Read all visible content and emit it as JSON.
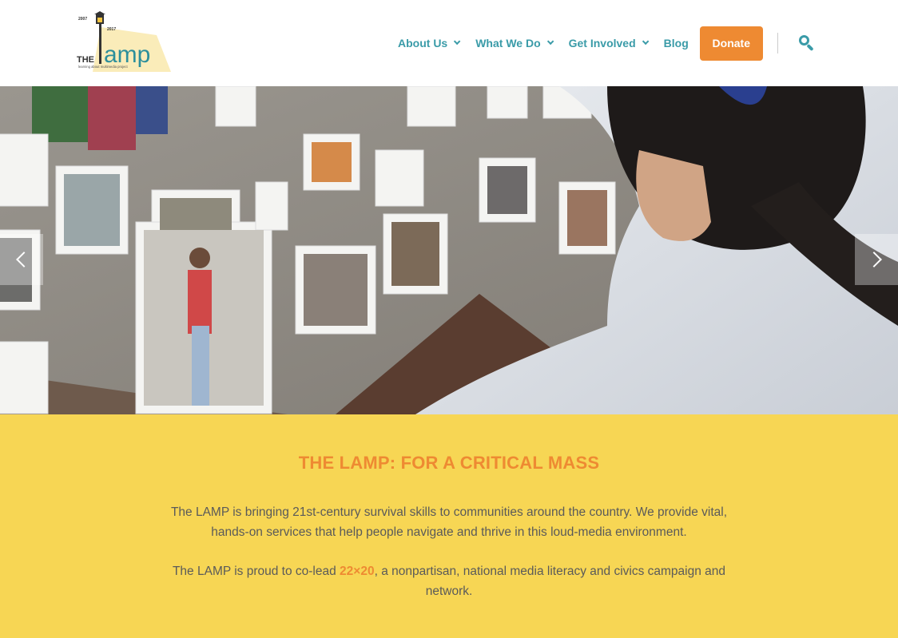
{
  "header": {
    "logo": {
      "text": "THE lamp",
      "years_left": "2007",
      "years_right": "2017",
      "tagline": "learning about multimedia project"
    },
    "nav": [
      {
        "label": "About Us",
        "has_dropdown": true
      },
      {
        "label": "What We Do",
        "has_dropdown": true
      },
      {
        "label": "Get Involved",
        "has_dropdown": true
      },
      {
        "label": "Blog",
        "has_dropdown": false
      }
    ],
    "donate_label": "Donate",
    "search_icon": "search-icon"
  },
  "hero": {
    "prev_icon": "chevron-left-icon",
    "next_icon": "chevron-right-icon"
  },
  "intro": {
    "heading": "THE LAMP: FOR A CRITICAL MASS",
    "paragraph1": "The LAMP is bringing 21st-century survival skills to communities around the country. We provide vital, hands-on services that help people navigate and thrive in this loud-media environment.",
    "paragraph2_before": "The LAMP is proud to co-lead ",
    "paragraph2_link": "22×20",
    "paragraph2_after": ", a nonpartisan, national media literacy and civics campaign and network."
  },
  "colors": {
    "accent_orange": "#ee8a32",
    "nav_teal": "#3a9ba8",
    "band_yellow": "#f7d654"
  }
}
